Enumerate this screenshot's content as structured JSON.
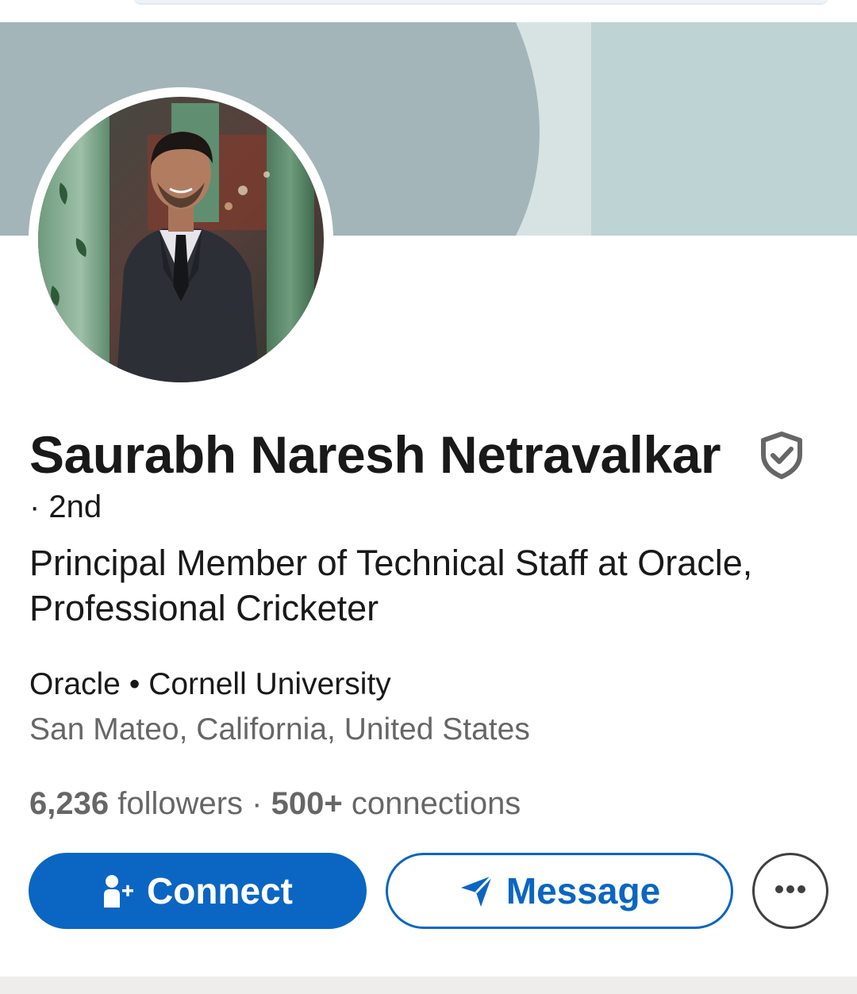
{
  "profile": {
    "name": "Saurabh Naresh Netravalkar",
    "degree": "· 2nd",
    "headline": "Principal Member of Technical Staff at Oracle, Professional Cricketer",
    "affiliations": "Oracle • Cornell University",
    "location": "San Mateo, California, United States",
    "followers_count": "6,236",
    "followers_label": " followers",
    "stats_separator": " · ",
    "connections_count": "500+",
    "connections_label": " connections"
  },
  "actions": {
    "connect_label": "Connect",
    "message_label": "Message"
  },
  "icons": {
    "verified": "verified-shield-icon",
    "connect": "add-person-icon",
    "message": "send-plane-icon",
    "more": "more-dots-icon"
  },
  "colors": {
    "primary": "#0a66c2",
    "banner_main": "#a3b5b9",
    "banner_light": "#bed3d3",
    "text_secondary": "#666666"
  }
}
